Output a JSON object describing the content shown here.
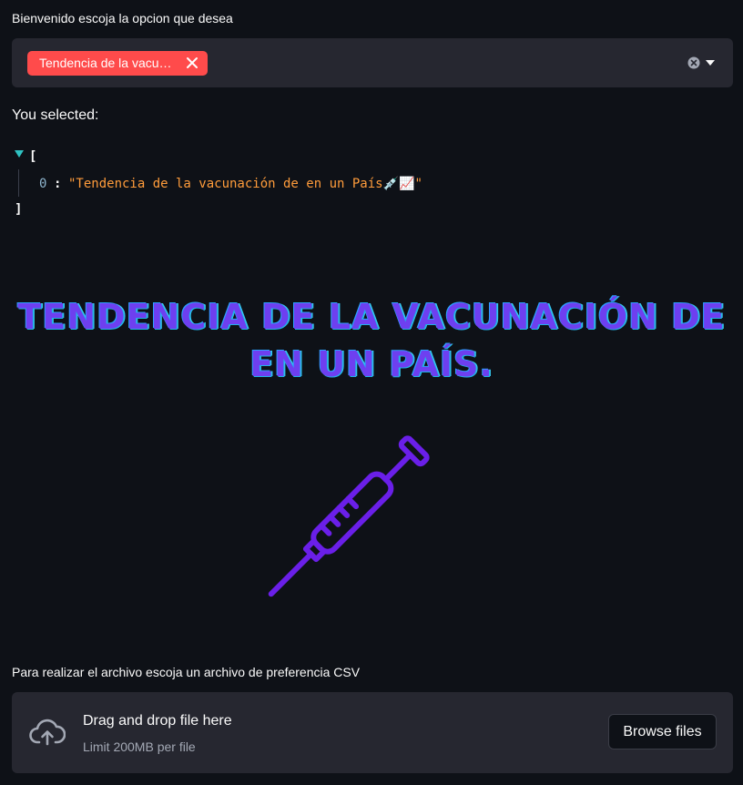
{
  "select": {
    "label": "Bienvenido escoja la opcion que desea",
    "chip_label": "Tendencia de la vacunación de en un País💉📈",
    "chip_color": "#ff4b4b",
    "icons": [
      "close-icon",
      "clear-all-icon",
      "chevron-down-icon"
    ]
  },
  "selection": {
    "heading": "You selected:",
    "json_open": "[",
    "json_close": "]",
    "items": [
      {
        "index": "0",
        "colon": ":",
        "value": "\"Tendencia de la vacunación de en un País💉📈\""
      }
    ]
  },
  "banner": {
    "line1": "TENDENCIA DE LA VACUNACIÓN DE",
    "line2": "EN UN PAÍS.",
    "text_color": "#6e3ff0",
    "outline_color": "#1fb3e6"
  },
  "illustration": {
    "icon": "syringe-icon",
    "color": "#6a1fe8"
  },
  "uploader": {
    "label": "Para realizar el archivo escoja un archivo de preferencia CSV",
    "drop_title": "Drag and drop file here",
    "limit": "Limit 200MB per file",
    "browse_label": "Browse files",
    "icon": "cloud-upload-icon"
  },
  "theme": {
    "background": "#0e1117",
    "panel": "#262730",
    "accent": "#ff4b4b"
  }
}
